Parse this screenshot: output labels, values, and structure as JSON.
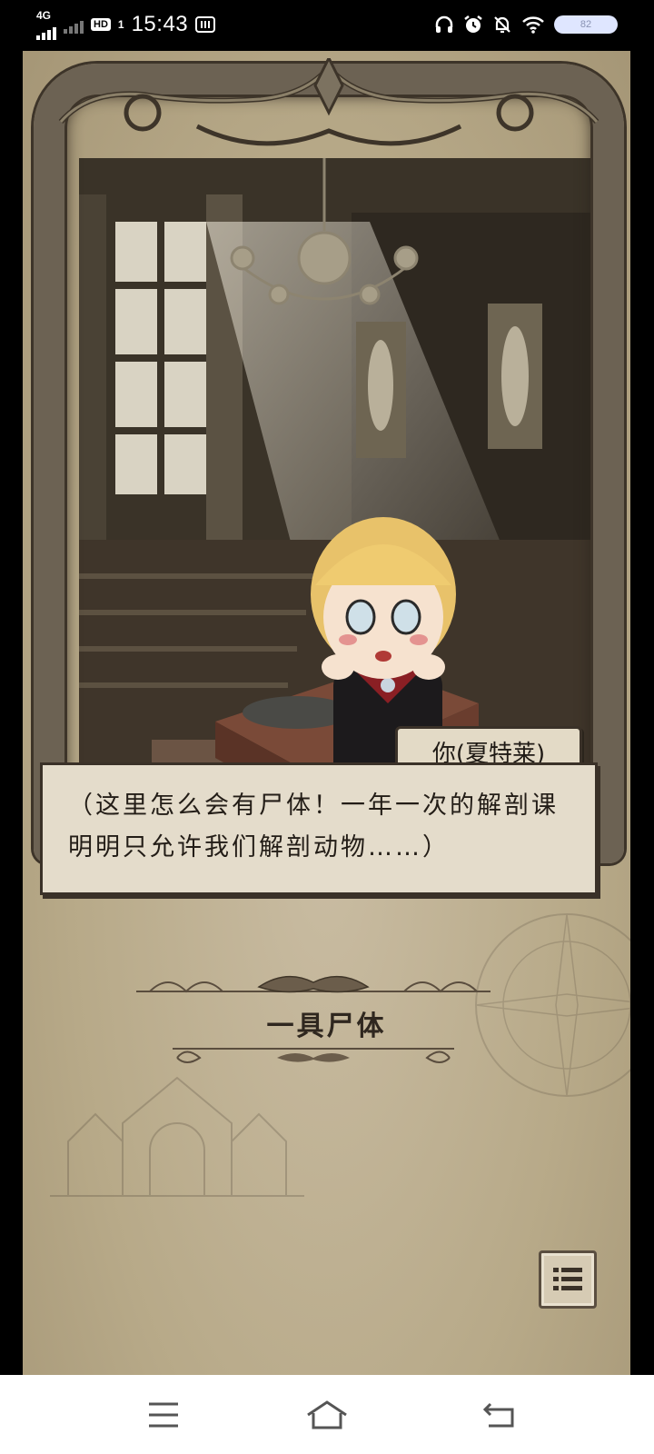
{
  "status_bar": {
    "network": "4G",
    "hd_label": "HD",
    "sim_index": "1",
    "time": "15:43",
    "battery_level": "82"
  },
  "scene": {
    "speaker_name": "你(夏特莱)",
    "dialog_text": "（这里怎么会有尸体！一年一次的解剖课明明只允许我们解剖动物……）"
  },
  "chapter": {
    "title": "一具尸体"
  },
  "colors": {
    "parchment": "#b7a988",
    "frame": "#6c6253",
    "dialog_bg": "#e4dccb",
    "ink": "#231d17"
  },
  "icons": {
    "log_button": "list-icon",
    "nav_menu": "menu-icon",
    "nav_home": "home-icon",
    "nav_back": "back-icon"
  }
}
